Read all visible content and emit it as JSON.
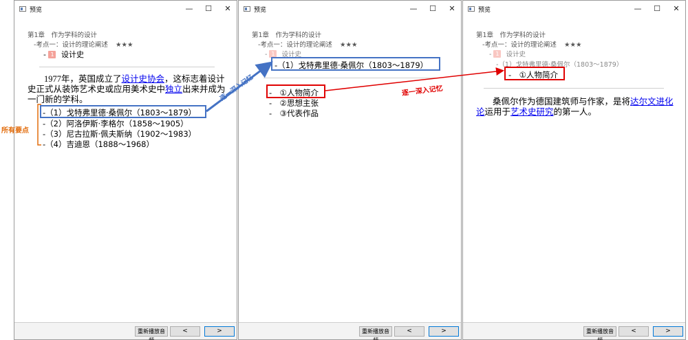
{
  "window_title": "预览",
  "controls": {
    "minimize": "—",
    "maximize": "☐",
    "close": "✕"
  },
  "bottom": {
    "replay": "重新播放音频",
    "prev": "<",
    "next": ">"
  },
  "breadcrumb": {
    "chapter": "第1章　作为学科的设计",
    "point": "-考点一：设计的理论阐述",
    "stars": "★★★",
    "section_num": "1",
    "section": "设计史"
  },
  "panel1": {
    "para_intro": "1977年，英国成立了",
    "link1": "设计史协会",
    "para_mid": "，这标志着设计史正式从装饰艺术史或应用美术史中",
    "link2": "独立",
    "para_end": "出来并成为一门新的学科。",
    "items": [
      "-（1）戈特弗里德·桑佩尔（1803～1879）",
      "-（2）阿洛伊斯·李格尔（1858～1905）",
      "-（3）尼古拉斯·佩夫斯纳（1902～1983）",
      "-（4）吉迪恩（1888～1968）"
    ]
  },
  "panel2": {
    "header": "-（1）戈特弗里德·桑佩尔（1803～1879）",
    "items": [
      "-　①人物简介",
      "-　②思想主张",
      "-　③代表作品"
    ]
  },
  "panel3": {
    "crumb": "-（1）戈特弗里德·桑佩尔（1803～1879）",
    "header": "-　①人物简介",
    "para_a": "桑佩尔作为德国建筑师与作家，是将",
    "link1": "达尔文进化论",
    "para_b": "运用于",
    "link2": "艺术史研究",
    "para_c": "的第一人。"
  },
  "annotations": {
    "all_points": "所有要点",
    "deeper_1": "逐一深入记忆",
    "deeper_2": "逐一深入记忆"
  },
  "colors": {
    "blue_box": "#4472c4",
    "red_box": "#e00000",
    "annot_orange": "#e26b0a",
    "link": "#0000ee"
  }
}
